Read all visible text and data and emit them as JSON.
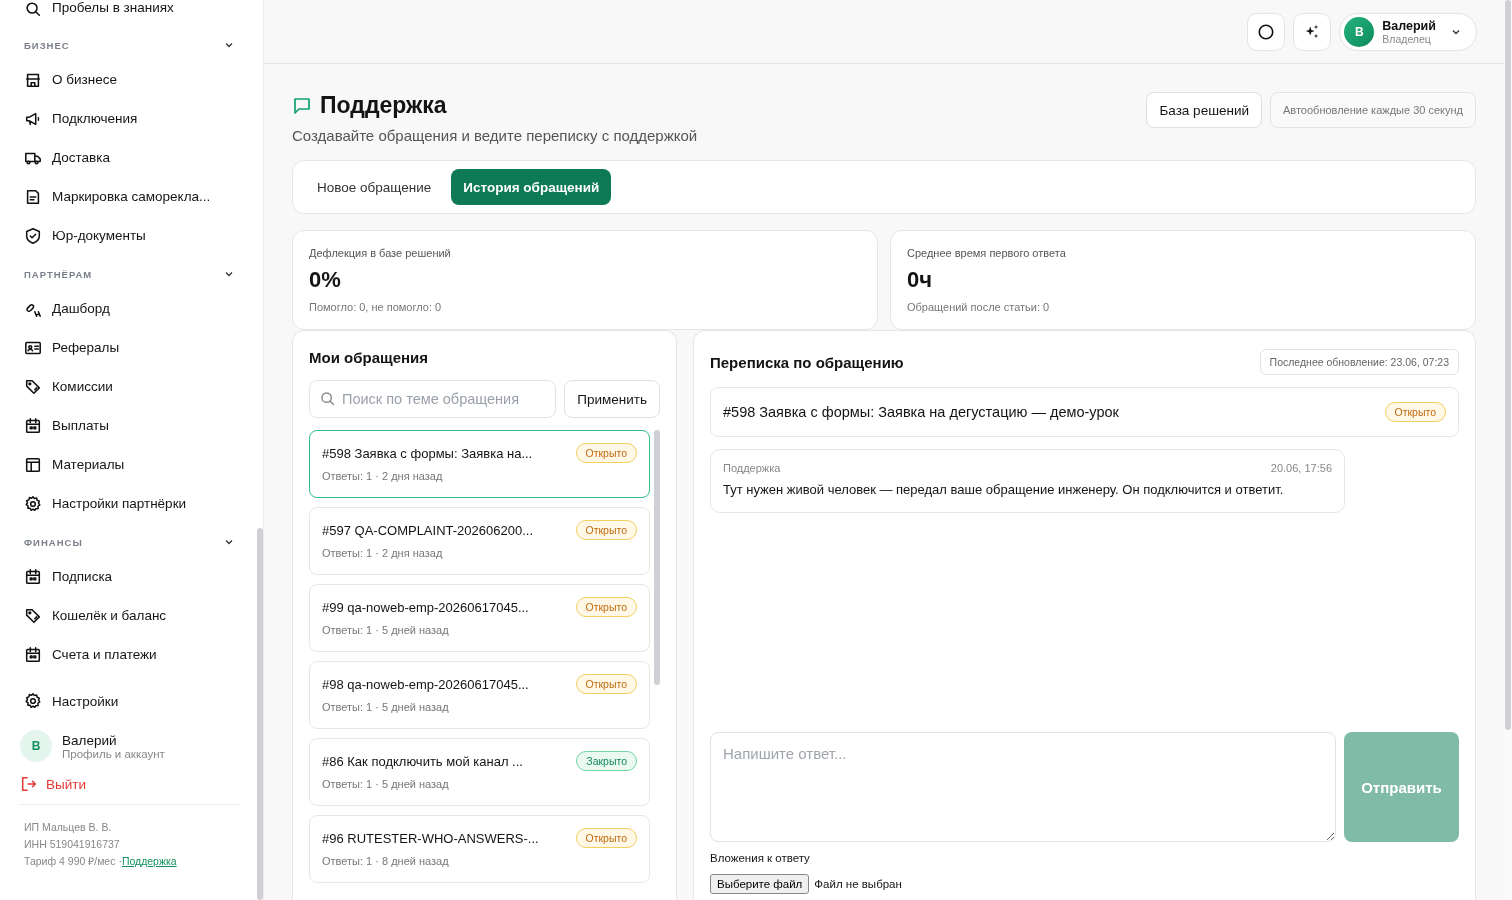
{
  "sidebar": {
    "top_item": {
      "label": "Пробелы в знаниях"
    },
    "sections": [
      {
        "title": "БИЗНЕС",
        "expanded": true,
        "items": [
          {
            "label": "О бизнесе"
          },
          {
            "label": "Подключения"
          },
          {
            "label": "Доставка"
          },
          {
            "label": "Маркировка саморекла..."
          },
          {
            "label": "Юр-документы"
          }
        ]
      },
      {
        "title": "ПАРТНЁРАМ",
        "expanded": true,
        "items": [
          {
            "label": "Дашборд"
          },
          {
            "label": "Рефералы"
          },
          {
            "label": "Комиссии"
          },
          {
            "label": "Выплаты"
          },
          {
            "label": "Материалы"
          },
          {
            "label": "Настройки партнёрки"
          }
        ]
      },
      {
        "title": "ФИНАНСЫ",
        "expanded": true,
        "items": [
          {
            "label": "Подписка"
          },
          {
            "label": "Кошелёк и баланс"
          },
          {
            "label": "Счета и платежи"
          }
        ]
      }
    ],
    "settings": {
      "label": "Настройки"
    },
    "profile": {
      "initial": "В",
      "name": "Валерий",
      "subtitle": "Профиль и аккаунт"
    },
    "logout": {
      "label": "Выйти"
    },
    "footer": {
      "company": "ИП Мальцев В. В.",
      "inn": "ИНН 519041916737",
      "tariff": "Тариф 4 990 ₽/мес ·",
      "support_link": "Поддержка"
    }
  },
  "header": {
    "user": {
      "initial": "В",
      "name": "Валерий",
      "role": "Владелец"
    }
  },
  "page": {
    "title": "Поддержка",
    "subtitle": "Создавайте обращения и ведите переписку с поддержкой",
    "kb_button": "База решений",
    "autorefresh": "Автообновление каждые 30 секунд"
  },
  "tabs": [
    {
      "label": "Новое обращение",
      "selected": false
    },
    {
      "label": "История обращений",
      "selected": true
    }
  ],
  "stats": [
    {
      "label": "Дефлекция в базе решений",
      "value": "0%",
      "note": "Помогло: 0, не помогло: 0"
    },
    {
      "label": "Среднее время первого ответа",
      "value": "0ч",
      "note": "Обращений после статьи: 0"
    }
  ],
  "tickets_panel": {
    "title": "Мои обращения",
    "search_placeholder": "Поиск по теме обращения",
    "apply_button": "Применить",
    "tickets": [
      {
        "title": "#598 Заявка с формы: Заявка на...",
        "status": "Открыто",
        "kind": "open",
        "meta": "Ответы: 1 · 2 дня назад",
        "selected": true
      },
      {
        "title": "#597 QA-COMPLAINT-202606200...",
        "status": "Открыто",
        "kind": "open",
        "meta": "Ответы: 1 · 2 дня назад",
        "selected": false
      },
      {
        "title": "#99 qa-noweb-emp-20260617045...",
        "status": "Открыто",
        "kind": "open",
        "meta": "Ответы: 1 · 5 дней назад",
        "selected": false
      },
      {
        "title": "#98 qa-noweb-emp-20260617045...",
        "status": "Открыто",
        "kind": "open",
        "meta": "Ответы: 1 · 5 дней назад",
        "selected": false
      },
      {
        "title": "#86 Как подключить мой канал ...",
        "status": "Закрыто",
        "kind": "closed",
        "meta": "Ответы: 1 · 5 дней назад",
        "selected": false
      },
      {
        "title": "#96 RUTESTER-WHO-ANSWERS-...",
        "status": "Открыто",
        "kind": "open",
        "meta": "Ответы: 1 · 8 дней назад",
        "selected": false
      }
    ]
  },
  "conversation": {
    "title": "Переписка по обращению",
    "last_update": "Последнее обновление: 23.06, 07:23",
    "ticket": {
      "title": "#598 Заявка с формы: Заявка на дегустацию — демо-урок",
      "status": "Открыто",
      "kind": "open"
    },
    "messages": [
      {
        "author": "Поддержка",
        "time": "20.06, 17:56",
        "text": "Тут нужен живой человек — передал ваше обращение инженеру. Он подключится и ответит."
      }
    ],
    "reply_placeholder": "Напишите ответ...",
    "send_button": {
      "label": "Отправить",
      "disabled": true
    },
    "attachments_label": "Вложения к ответу",
    "file_button": "Выберите файл",
    "file_status": "Файл не выбран"
  }
}
